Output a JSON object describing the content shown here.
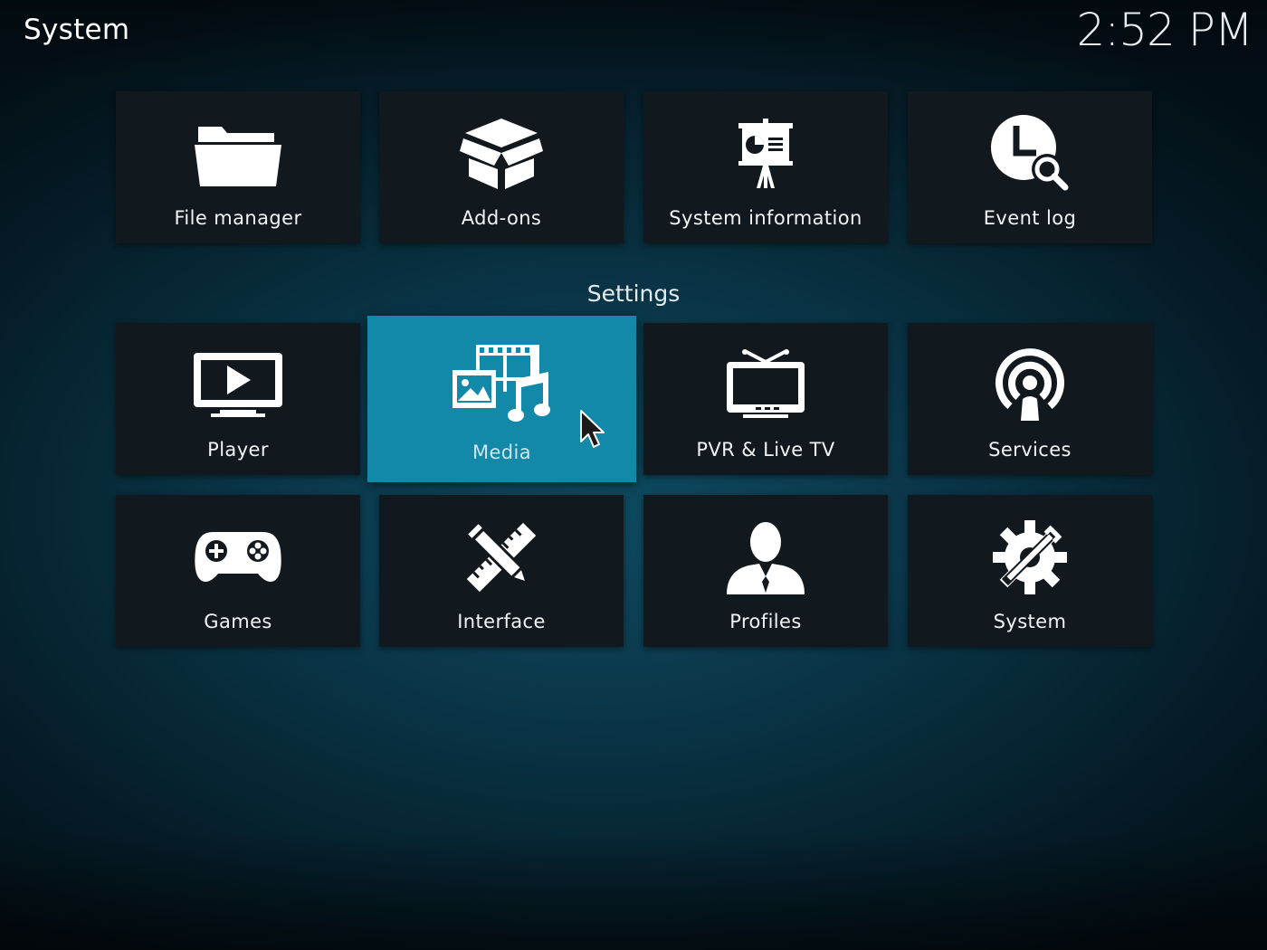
{
  "header": {
    "title": "System",
    "clock": "2:52 PM"
  },
  "top_row": [
    {
      "label": "File manager",
      "icon": "folder-icon"
    },
    {
      "label": "Add-ons",
      "icon": "box-icon"
    },
    {
      "label": "System information",
      "icon": "presentation-icon"
    },
    {
      "label": "Event log",
      "icon": "clock-search-icon"
    }
  ],
  "settings": {
    "heading": "Settings",
    "selected": "Media",
    "items": [
      {
        "label": "Player",
        "icon": "monitor-play-icon"
      },
      {
        "label": "Media",
        "icon": "media-icon"
      },
      {
        "label": "PVR & Live TV",
        "icon": "tv-icon"
      },
      {
        "label": "Services",
        "icon": "broadcast-icon"
      },
      {
        "label": "Games",
        "icon": "gamepad-icon"
      },
      {
        "label": "Interface",
        "icon": "pencil-ruler-icon"
      },
      {
        "label": "Profiles",
        "icon": "user-icon"
      },
      {
        "label": "System",
        "icon": "gear-wrench-icon"
      }
    ]
  },
  "colors": {
    "accent": "#1289a9",
    "tile": "#11191e",
    "background": "#0b3a4d"
  }
}
